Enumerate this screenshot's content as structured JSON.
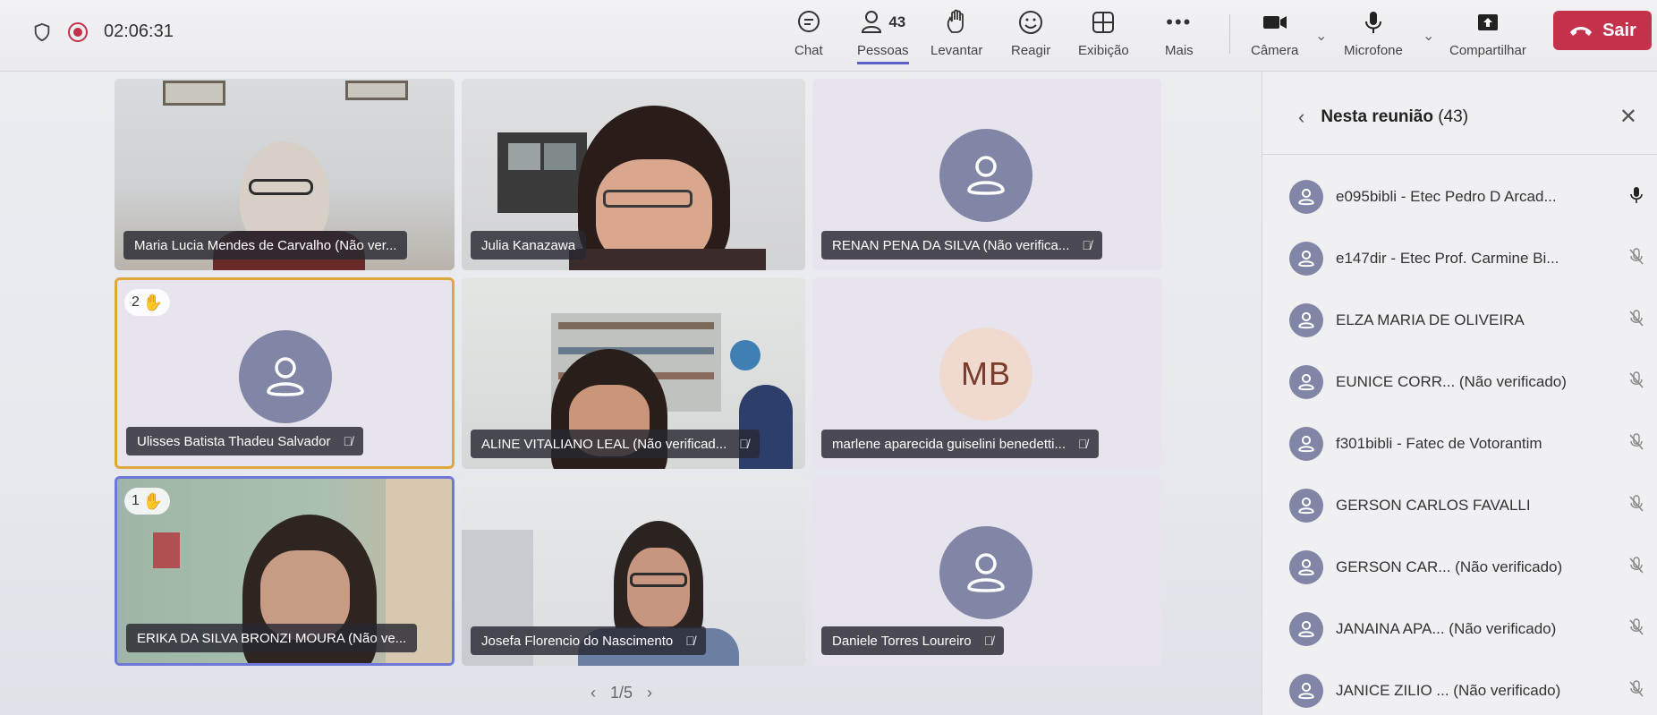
{
  "topbar": {
    "timer": "02:06:31",
    "chat_label": "Chat",
    "people_label": "Pessoas",
    "people_count": "43",
    "raise_label": "Levantar",
    "react_label": "Reagir",
    "view_label": "Exibição",
    "more_label": "Mais",
    "camera_label": "Câmera",
    "mic_label": "Microfone",
    "share_label": "Compartilhar",
    "leave_label": "Sair"
  },
  "tiles": [
    {
      "name": "Maria Lucia Mendes de Carvalho (Não ver..."
    },
    {
      "name": "Julia Kanazawa"
    },
    {
      "name": "RENAN PENA DA SILVA (Não verifica..."
    },
    {
      "name": "Ulisses Batista Thadeu Salvador",
      "hand": "2"
    },
    {
      "name": "ALINE VITALIANO LEAL (Não verificad..."
    },
    {
      "name": "marlene aparecida guiselini benedetti...",
      "initials": "MB"
    },
    {
      "name": "ERIKA DA SILVA BRONZI MOURA (Não ve...",
      "hand": "1"
    },
    {
      "name": "Josefa Florencio do Nascimento"
    },
    {
      "name": "Daniele Torres Loureiro"
    }
  ],
  "pager": {
    "text": "1/5"
  },
  "panel": {
    "title": "Nesta reunião",
    "count": "(43)",
    "participants": [
      {
        "name": "e095bibli - Etec Pedro D Arcad...",
        "mic": "on"
      },
      {
        "name": "e147dir - Etec Prof. Carmine Bi...",
        "mic": "off"
      },
      {
        "name": "ELZA MARIA DE OLIVEIRA",
        "mic": "off"
      },
      {
        "name": "EUNICE CORR... (Não verificado)",
        "mic": "off"
      },
      {
        "name": "f301bibli - Fatec de Votorantim",
        "mic": "off"
      },
      {
        "name": "GERSON CARLOS FAVALLI",
        "mic": "off"
      },
      {
        "name": "GERSON CAR... (Não verificado)",
        "mic": "off"
      },
      {
        "name": "JANAINA APA... (Não verificado)",
        "mic": "off"
      },
      {
        "name": "JANICE ZILIO ... (Não verificado)",
        "mic": "off"
      }
    ]
  },
  "colors": {
    "leave": "#c4314b",
    "accent": "#5b5fc7",
    "avatar": "#8186a6",
    "hand": "#e8a23a"
  }
}
